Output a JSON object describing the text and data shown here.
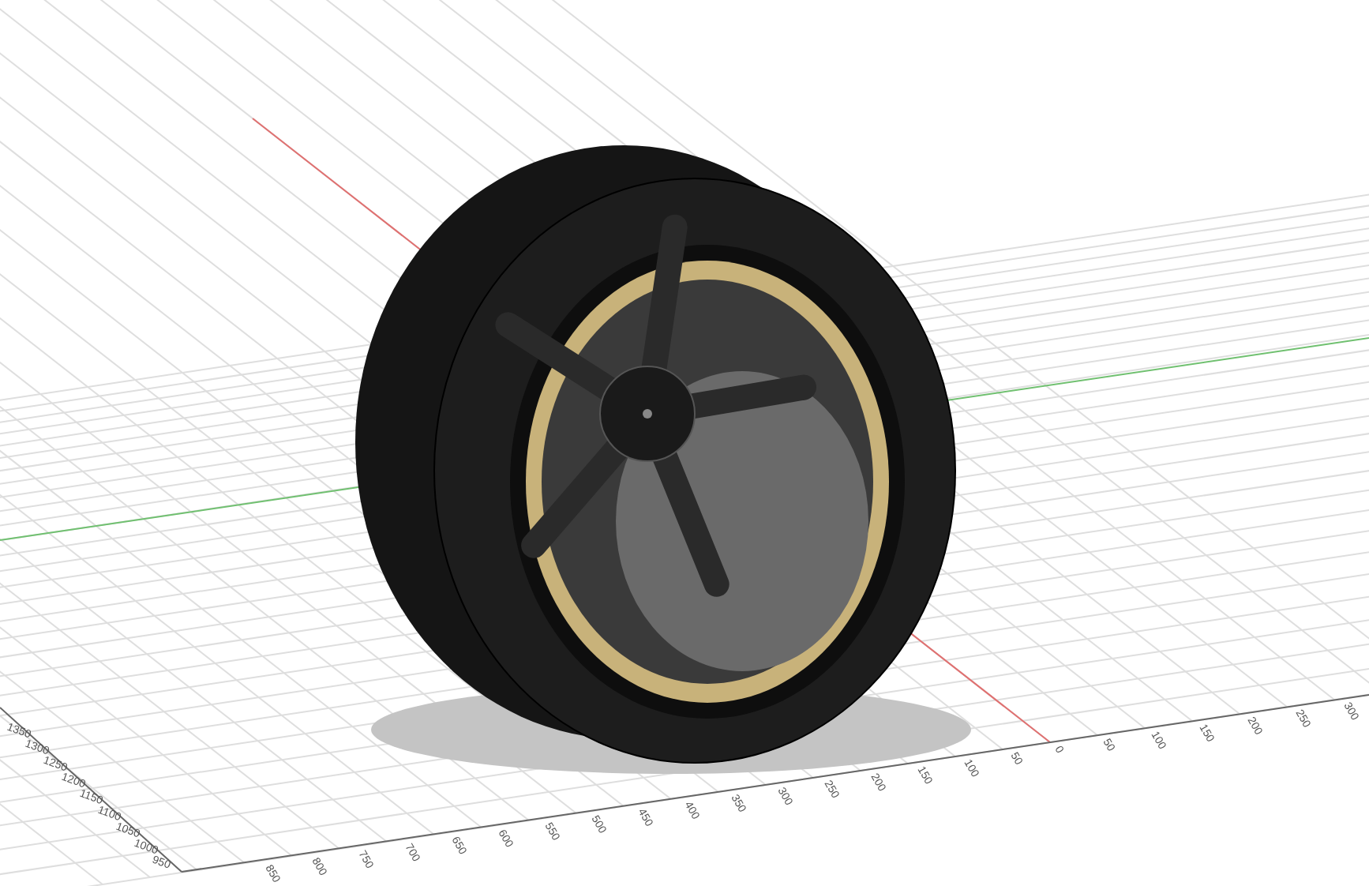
{
  "viewport": {
    "ruler_labels_front": [
      "0",
      "50",
      "100",
      "150",
      "200",
      "250",
      "300"
    ],
    "ruler_labels_back": [
      "50",
      "100",
      "150",
      "200",
      "250",
      "300",
      "350",
      "400",
      "450",
      "500",
      "550",
      "600",
      "650",
      "700",
      "750",
      "800",
      "850"
    ],
    "ruler_labels_side": [
      "950",
      "1000",
      "1050",
      "1100",
      "1150",
      "1200",
      "1250",
      "1300",
      "1350"
    ]
  }
}
